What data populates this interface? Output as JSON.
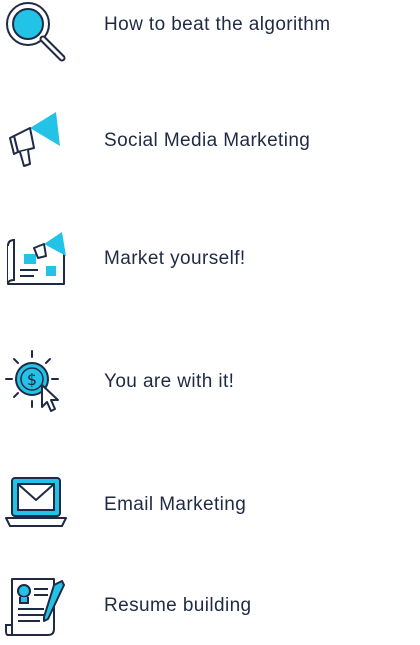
{
  "colors": {
    "accent": "#22c3e6",
    "outline": "#1f2a44",
    "text": "#1f2a44"
  },
  "items": [
    {
      "label": "How to beat the algorithm",
      "icon": "magnifier-icon"
    },
    {
      "label": "Social Media Marketing",
      "icon": "megaphone-icon"
    },
    {
      "label": "Market yourself!",
      "icon": "blueprint-icon"
    },
    {
      "label": "You are with it!",
      "icon": "dollar-cursor-icon"
    },
    {
      "label": "Email Marketing",
      "icon": "email-laptop-icon"
    },
    {
      "label": "Resume building",
      "icon": "resume-document-icon"
    }
  ]
}
